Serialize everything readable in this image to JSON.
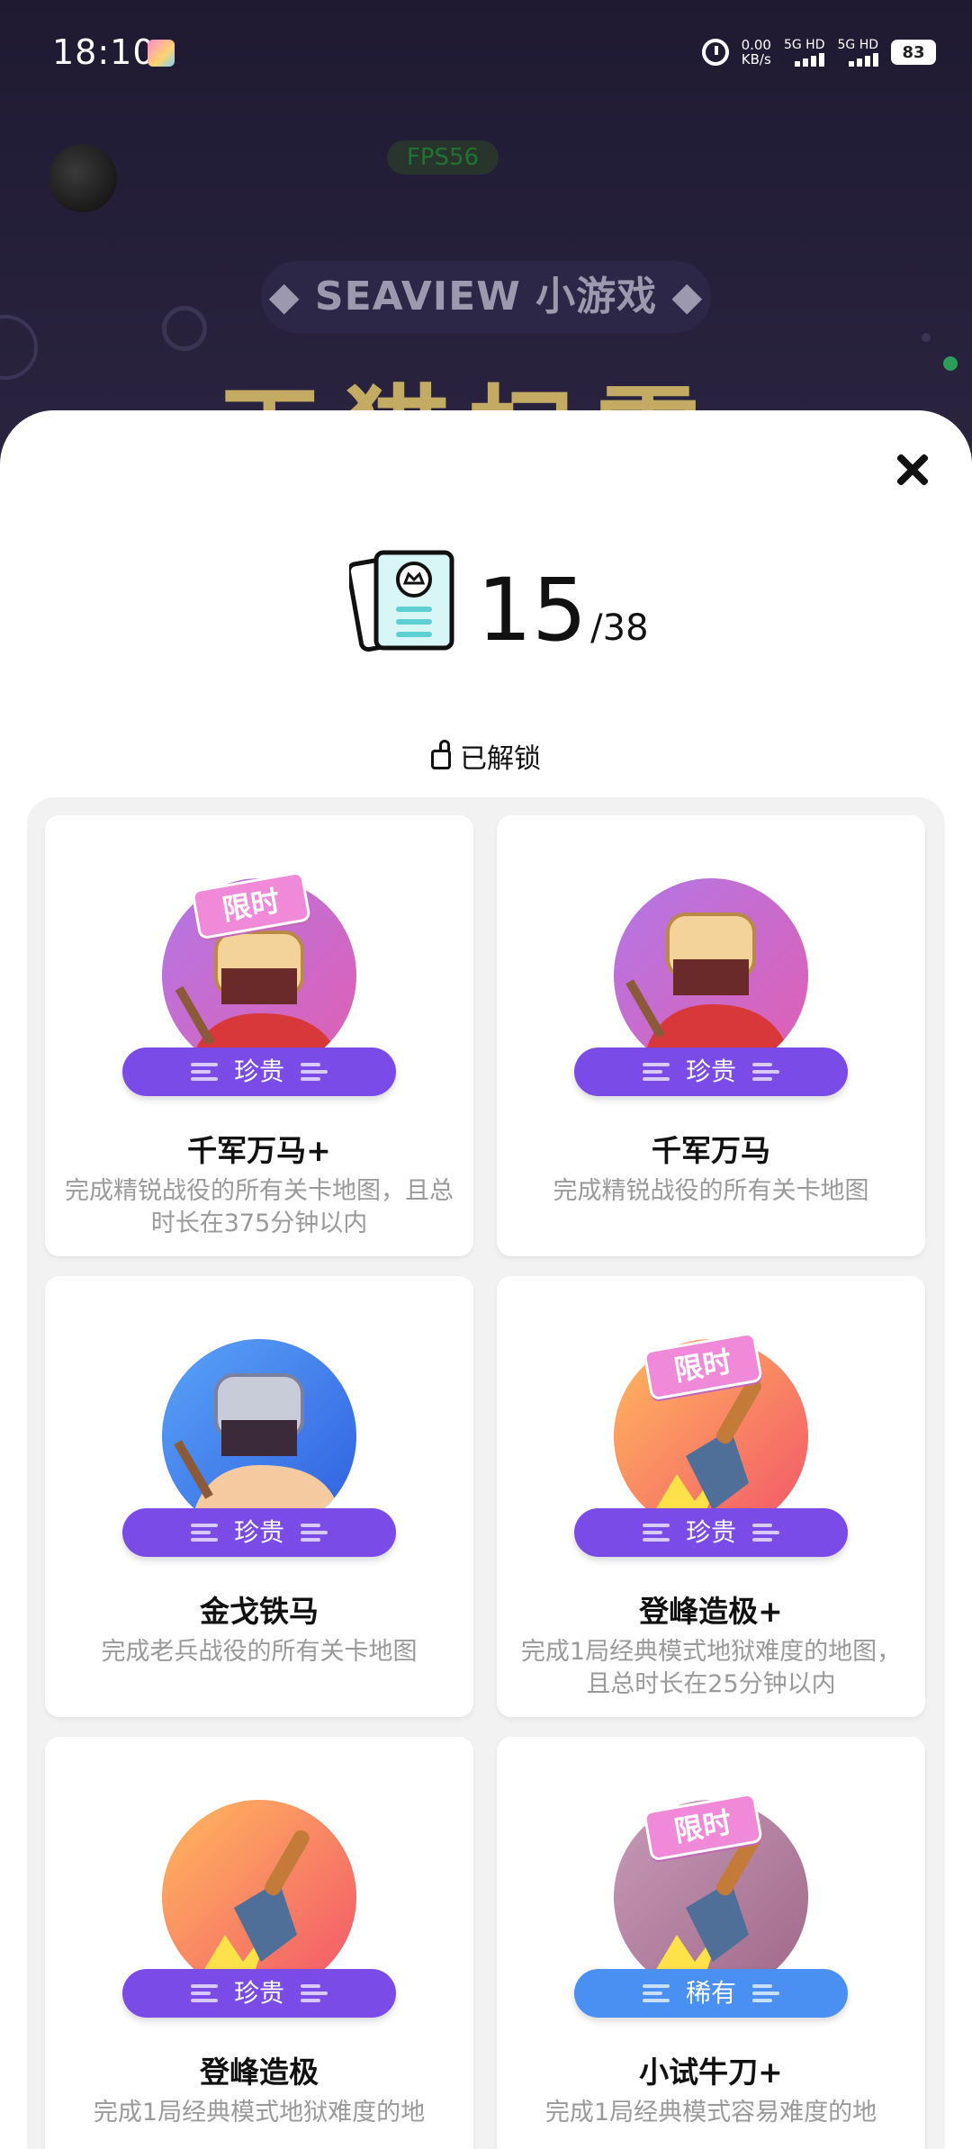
{
  "status_bar": {
    "time": "18:10",
    "net_speed_value": "0.00",
    "net_speed_unit": "KB/s",
    "sim1": "5G HD",
    "sim2": "5G HD",
    "battery": "83"
  },
  "background": {
    "fps": "FPS56",
    "game_title": "◆ SEAVIEW 小游戏 ◆",
    "big_title": "天猫扫雷"
  },
  "sheet": {
    "counter": {
      "unlocked": "15",
      "total": "/38"
    },
    "section_label": "已解锁",
    "achievements": [
      {
        "title": "千军万马+",
        "desc": "完成精锐战役的所有关卡地图，且总时长在375分钟以内",
        "rarity": "珍贵",
        "limited": "限时",
        "theme": "purple-knight-gold"
      },
      {
        "title": "千军万马",
        "desc": "完成精锐战役的所有关卡地图",
        "rarity": "珍贵",
        "limited": "",
        "theme": "purple-knight-gold"
      },
      {
        "title": "金戈铁马",
        "desc": "完成老兵战役的所有关卡地图",
        "rarity": "珍贵",
        "limited": "",
        "theme": "blue-knight-silver"
      },
      {
        "title": "登峰造极+",
        "desc": "完成1局经典模式地狱难度的地图，且总时长在25分钟以内",
        "rarity": "珍贵",
        "limited": "限时",
        "theme": "orange-shovel"
      },
      {
        "title": "登峰造极",
        "desc": "完成1局经典模式地狱难度的地",
        "rarity": "珍贵",
        "limited": "",
        "theme": "orange-shovel"
      },
      {
        "title": "小试牛刀+",
        "desc": "完成1局经典模式容易难度的地",
        "rarity": "稀有",
        "limited": "限时",
        "theme": "mauve-shovel"
      }
    ]
  }
}
